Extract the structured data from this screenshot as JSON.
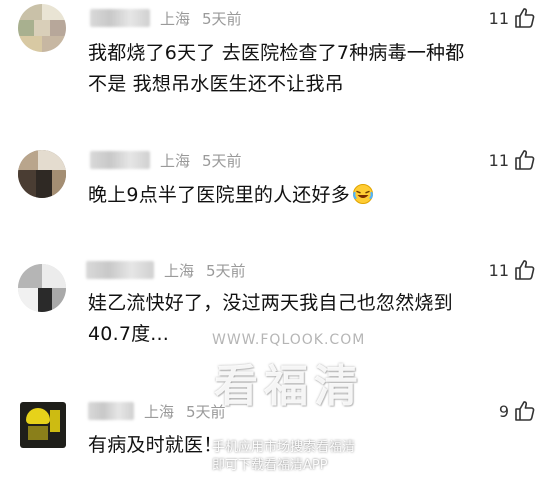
{
  "comments": [
    {
      "location": "上海",
      "time": "5天前",
      "likes": "11",
      "text_lines": [
        "我都烧了6天了 去医院检查了7种病毒一种都",
        "不是 我想吊水医生还不让我吊"
      ]
    },
    {
      "location": "上海",
      "time": "5天前",
      "likes": "11",
      "text": "晚上9点半了医院里的人还好多",
      "emoji": "laughing-tears-emoji"
    },
    {
      "location": "上海",
      "time": "5天前",
      "likes": "11",
      "text_lines": [
        "娃乙流快好了，没过两天我自己也忽然烧到",
        "40.7度..."
      ]
    },
    {
      "location": "上海",
      "time": "5天前",
      "likes": "9",
      "text": "有病及时就医！"
    }
  ],
  "watermark": {
    "url": "WWW.FQLOOK.COM",
    "brand": "看福清",
    "line1": "手机应用市场搜索看福清",
    "line2": "即可下载看福清APP"
  },
  "colors": {
    "meta_gray": "#9a9a9a",
    "text": "#111111",
    "background": "#ffffff"
  }
}
